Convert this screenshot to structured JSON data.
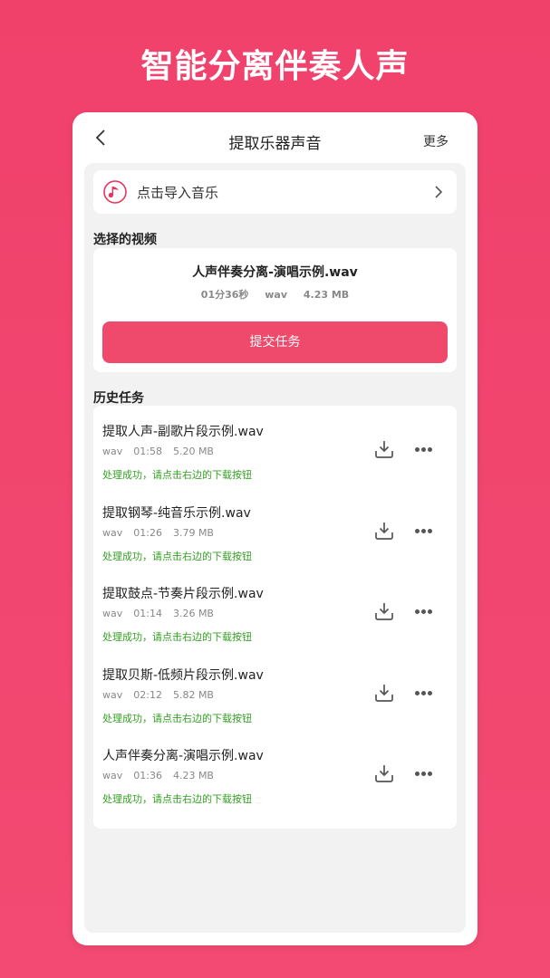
{
  "banner": "智能分离伴奏人声",
  "header": {
    "title": "提取乐器声音",
    "more": "更多",
    "back_icon": "chevron-left-icon"
  },
  "import": {
    "label": "点击导入音乐",
    "icon": "music-note-icon",
    "chevron_icon": "chevron-right-icon"
  },
  "selected": {
    "section_title": "选择的视频",
    "file_name": "人声伴奏分离-演唱示例.wav",
    "duration": "01分36秒",
    "format": "wav",
    "size": "4.23 MB",
    "submit_label": "提交任务"
  },
  "history": {
    "section_title": "历史任务",
    "tasks": [
      {
        "name": "提取人声-副歌片段示例.wav",
        "format": "wav",
        "duration": "01:58",
        "size": "5.20 MB",
        "status": "处理成功，请点击右边的下载按钮"
      },
      {
        "name": "提取钢琴-纯音乐示例.wav",
        "format": "wav",
        "duration": "01:26",
        "size": "3.79 MB",
        "status": "处理成功，请点击右边的下载按钮"
      },
      {
        "name": "提取鼓点-节奏片段示例.wav",
        "format": "wav",
        "duration": "01:14",
        "size": "3.26 MB",
        "status": "处理成功，请点击右边的下载按钮"
      },
      {
        "name": "提取贝斯-低频片段示例.wav",
        "format": "wav",
        "duration": "02:12",
        "size": "5.82 MB",
        "status": "处理成功，请点击右边的下载按钮"
      },
      {
        "name": "人声伴奏分离-演唱示例.wav",
        "format": "wav",
        "duration": "01:36",
        "size": "4.23 MB",
        "status": "处理成功，请点击右边的下载按钮"
      }
    ]
  },
  "colors": {
    "background": "#f0416b",
    "accent": "#ef4a6c",
    "success": "#35a024"
  }
}
